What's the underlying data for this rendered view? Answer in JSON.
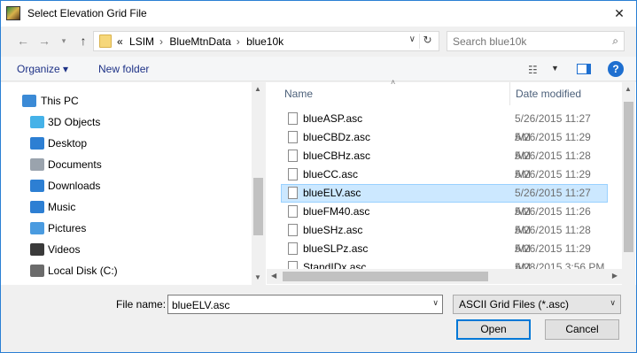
{
  "window": {
    "title": "Select Elevation Grid File"
  },
  "nav": {
    "breadcrumbs": [
      "«",
      "LSIM",
      "BlueMtnData",
      "blue10k"
    ],
    "search_placeholder": "Search blue10k"
  },
  "toolbar": {
    "organize_label": "Organize ▾",
    "new_folder_label": "New folder"
  },
  "sidebar": {
    "items": [
      {
        "label": "This PC",
        "icon": "computer-icon",
        "color": "#3b8ad6"
      },
      {
        "label": "3D Objects",
        "icon": "cube-icon",
        "color": "#45b2e8"
      },
      {
        "label": "Desktop",
        "icon": "desktop-icon",
        "color": "#2d7fd3"
      },
      {
        "label": "Documents",
        "icon": "document-icon",
        "color": "#9aa3ad"
      },
      {
        "label": "Downloads",
        "icon": "download-arrow-icon",
        "color": "#2d7fd3"
      },
      {
        "label": "Music",
        "icon": "music-note-icon",
        "color": "#2d7fd3"
      },
      {
        "label": "Pictures",
        "icon": "picture-icon",
        "color": "#4a9be0"
      },
      {
        "label": "Videos",
        "icon": "film-icon",
        "color": "#3a3a3a"
      },
      {
        "label": "Local Disk (C:)",
        "icon": "drive-icon",
        "color": "#6b6b6b"
      }
    ]
  },
  "file_list": {
    "columns": [
      "Name",
      "Date modified"
    ],
    "rows": [
      {
        "name": "blueASP.asc",
        "date": "5/26/2015 11:27 AM",
        "selected": false
      },
      {
        "name": "blueCBDz.asc",
        "date": "5/26/2015 11:29 AM",
        "selected": false
      },
      {
        "name": "blueCBHz.asc",
        "date": "5/26/2015 11:28 AM",
        "selected": false
      },
      {
        "name": "blueCC.asc",
        "date": "5/26/2015 11:29 AM",
        "selected": false
      },
      {
        "name": "blueELV.asc",
        "date": "5/26/2015 11:27 AM",
        "selected": true
      },
      {
        "name": "blueFM40.asc",
        "date": "5/26/2015 11:26 AM",
        "selected": false
      },
      {
        "name": "blueSHz.asc",
        "date": "5/26/2015 11:28 AM",
        "selected": false
      },
      {
        "name": "blueSLPz.asc",
        "date": "5/26/2015 11:29 AM",
        "selected": false
      },
      {
        "name": "StandIDx.asc",
        "date": "5/28/2015 3:56 PM",
        "selected": false
      }
    ]
  },
  "footer": {
    "file_name_label": "File name:",
    "file_name_value": "blueELV.asc",
    "file_type_value": "ASCII Grid Files (*.asc)",
    "open_label": "Open",
    "cancel_label": "Cancel"
  },
  "colors": {
    "accent": "#0078d7",
    "selection_bg": "#cce8ff",
    "selection_border": "#99d1ff"
  }
}
